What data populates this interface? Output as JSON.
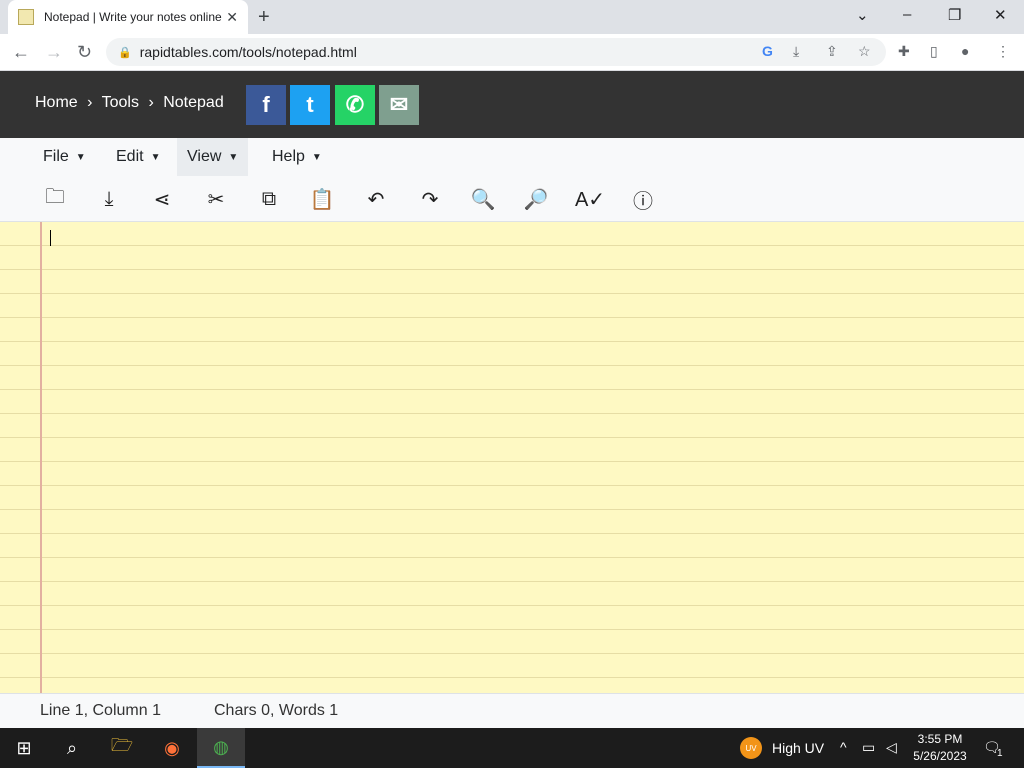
{
  "browser": {
    "tab_title": "Notepad | Write your notes online",
    "tab_close": "✕",
    "new_tab": "+",
    "url": "rapidtables.com/tools/notepad.html",
    "window_controls": [
      "⌄",
      "–",
      "❐",
      "✕"
    ]
  },
  "site": {
    "breadcrumb": [
      "Home",
      "›",
      "Tools",
      "›",
      "Notepad"
    ],
    "social": [
      {
        "name": "facebook",
        "glyph": "f",
        "color": "#3b5998"
      },
      {
        "name": "twitter",
        "glyph": "t",
        "color": "#1da1f2"
      },
      {
        "name": "whatsapp",
        "glyph": "✆",
        "color": "#25d366"
      },
      {
        "name": "email",
        "glyph": "✉",
        "color": "#7f9f8f"
      }
    ]
  },
  "menu": {
    "file": "File",
    "edit": "Edit",
    "view": "View",
    "help": "Help"
  },
  "toolbar_icons": [
    "open-folder-icon",
    "download-icon",
    "share-icon",
    "cut-icon",
    "copy-icon",
    "paste-icon",
    "undo-icon",
    "redo-icon",
    "zoom-out-icon",
    "zoom-in-icon",
    "spellcheck-icon",
    "help-icon"
  ],
  "status": {
    "position": "Line 1, Column 1",
    "counts": "Chars 0, Words 1"
  },
  "taskbar": {
    "weather": "High UV",
    "uv_badge": "UV",
    "time": "3:55 PM",
    "date": "5/26/2023",
    "notifications": "1"
  }
}
